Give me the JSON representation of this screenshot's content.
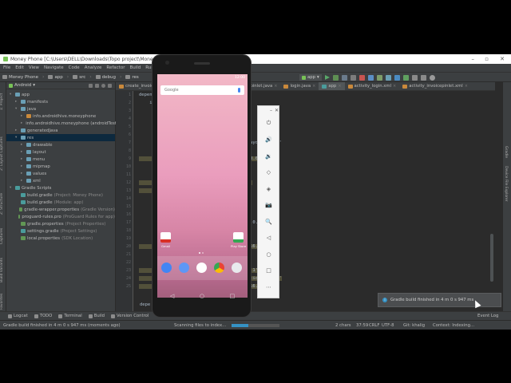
{
  "window": {
    "title": "Money Phone [C:\\Users\\DELL\\Downloads\\Topo project\\Money Phone] - app - Android Studio"
  },
  "menu": [
    "File",
    "Edit",
    "View",
    "Navigate",
    "Code",
    "Analyze",
    "Refactor",
    "Build",
    "Run",
    "Tools",
    "VCS",
    "Window",
    "Help"
  ],
  "toolbar": {
    "breadcrumbs": [
      "Money Phone",
      "app",
      "src",
      "debug",
      "res"
    ],
    "run_config": "app"
  },
  "project_panel": {
    "view_label": "Android",
    "tree": [
      {
        "label": "app",
        "indent": 0,
        "arrow": "▾",
        "icon": "folder-icon"
      },
      {
        "label": "manifests",
        "indent": 1,
        "arrow": "▸",
        "icon": "folder-icon"
      },
      {
        "label": "java",
        "indent": 1,
        "arrow": "▾",
        "icon": "folder-icon"
      },
      {
        "label": "info.androidhive.moneyphone",
        "indent": 2,
        "arrow": "▸",
        "icon": "package-icon"
      },
      {
        "label": "info.androidhive.moneyphone (androidTest)",
        "indent": 2,
        "arrow": "▸",
        "icon": "package-icon"
      },
      {
        "label": "generatedJava",
        "indent": 1,
        "arrow": "▸",
        "icon": "folder-icon"
      },
      {
        "label": "res",
        "indent": 1,
        "arrow": "▾",
        "icon": "folder-icon",
        "selected": true
      },
      {
        "label": "drawable",
        "indent": 2,
        "arrow": "▸",
        "icon": "folder-icon"
      },
      {
        "label": "layout",
        "indent": 2,
        "arrow": "▸",
        "icon": "folder-icon"
      },
      {
        "label": "menu",
        "indent": 2,
        "arrow": "▸",
        "icon": "folder-icon"
      },
      {
        "label": "mipmap",
        "indent": 2,
        "arrow": "▸",
        "icon": "folder-icon"
      },
      {
        "label": "values",
        "indent": 2,
        "arrow": "▸",
        "icon": "folder-icon"
      },
      {
        "label": "xml",
        "indent": 2,
        "arrow": "▸",
        "icon": "folder-icon"
      },
      {
        "label": "Gradle Scripts",
        "indent": 0,
        "arrow": "▾",
        "icon": "gradle-icon"
      },
      {
        "label": "build.gradle",
        "muted": "(Project: Money Phone)",
        "indent": 1,
        "icon": "gradle-file-icon"
      },
      {
        "label": "build.gradle",
        "muted": "(Module: app)",
        "indent": 1,
        "icon": "gradle-file-icon"
      },
      {
        "label": "gradle-wrapper.properties",
        "muted": "(Gradle Version)",
        "indent": 1,
        "icon": "properties-icon"
      },
      {
        "label": "proguard-rules.pro",
        "muted": "(ProGuard Rules for app)",
        "indent": 1,
        "icon": "properties-icon"
      },
      {
        "label": "gradle.properties",
        "muted": "(Project Properties)",
        "indent": 1,
        "icon": "properties-icon"
      },
      {
        "label": "settings.gradle",
        "muted": "(Project Settings)",
        "indent": 1,
        "icon": "gradle-file-icon"
      },
      {
        "label": "local.properties",
        "muted": "(SDK Location)",
        "indent": 1,
        "icon": "properties-icon"
      }
    ]
  },
  "editor": {
    "tabs": [
      {
        "label": "create_invoice.java",
        "icon": "java-icon"
      },
      {
        "label": "invoicenew.java",
        "icon": "java-icon"
      },
      {
        "label": "invoicepinlet.java",
        "icon": "java-icon"
      },
      {
        "label": "login.java",
        "icon": "java-icon"
      },
      {
        "label": "app",
        "icon": "gradle-icon",
        "active": true
      },
      {
        "label": "activity_login.xml",
        "icon": "xml-icon"
      },
      {
        "label": "activity_invoicepinlet.xml",
        "icon": "xml-icon"
      }
    ],
    "code_lines": [
      {
        "text": "dependencies {",
        "hl": false
      },
      {
        "text": "    i",
        "hl": false
      },
      {
        "text": "                                  ibs')",
        "hl": false
      },
      {
        "text": "                                  1.1'",
        "hl": false
      },
      {
        "text": "                                  1.1'",
        "hl": false
      },
      {
        "text": "",
        "hl": false
      },
      {
        "text": "                                  traint-layout:1.1.3'",
        "hl": false
      },
      {
        "text": "                                  :1.1'",
        "hl": false
      },
      {
        "text": "                                  ne-core:3.0.2'",
        "hl": true
      },
      {
        "text": "",
        "hl": false
      },
      {
        "text": "",
        "hl": false
      },
      {
        "text": "                                  0:27.1.1'",
        "hl": true
      },
      {
        "text": "                                  0.0'",
        "hl": true
      },
      {
        "text": "                                  28'",
        "hl": false
      },
      {
        "text": "",
        "hl": false
      },
      {
        "text": "",
        "hl": false
      },
      {
        "text": "                                  tions:29.0.0'",
        "hl": false
      },
      {
        "text": "",
        "hl": false
      },
      {
        "text": "",
        "hl": false
      },
      {
        "text": "                                  ne-auth:16.0.1'",
        "hl": true
      },
      {
        "text": "",
        "hl": false
      },
      {
        "text": "",
        "hl": false
      },
      {
        "text": "                                  ase:16.0.1'",
        "hl": true
      },
      {
        "text": "                                  ne-analytics:16.0.1'",
        "hl": true
      },
      {
        "text": "                                  ne-core:16.0.1'",
        "hl": true
      }
    ],
    "bottom_fragment": "depe"
  },
  "emulator": {
    "status_time": "12:00",
    "search_label": "Google",
    "apps": [
      {
        "label": "Gmail",
        "color": "#ffffff",
        "accent": "#d93025"
      },
      {
        "label": "Play Store",
        "color": "#ffffff",
        "accent": "#34a853"
      }
    ],
    "dock": [
      {
        "name": "phone",
        "color": "#4285f4"
      },
      {
        "name": "messages",
        "color": "#5e97f6"
      },
      {
        "name": "app-drawer",
        "color": "#ffffff"
      },
      {
        "name": "chrome",
        "color": "#fbbc05"
      },
      {
        "name": "camera",
        "color": "#e8eaed"
      }
    ],
    "nav": [
      "◁",
      "○",
      "□"
    ],
    "controls": [
      "⏻",
      "🔊",
      "🔉",
      "◇",
      "◈",
      "📷",
      "🔍",
      "◁",
      "○",
      "□",
      "⋯"
    ]
  },
  "notification": {
    "text": "Gradle build finished in 4 m 0 s 947 ms"
  },
  "bottom_tabs": [
    "Logcat",
    "TODO",
    "Terminal",
    "Build",
    "Version Control"
  ],
  "right_panel_label": "Event Log",
  "statusbar": {
    "message": "Gradle build finished in 4 m 0 s 947 ms (moments ago)",
    "progress": "Scanning files to index...",
    "info": "2 chars",
    "position": "37:59",
    "line_sep": "CRLF",
    "encoding": "UTF-8",
    "git": "Git: khalig",
    "context": "Context: Indexing..."
  },
  "side_labels": {
    "left": [
      "1: Project",
      "2: Layout Captures",
      "Z: Structure",
      "Captures",
      "Build Variants",
      "Favorites"
    ],
    "right": [
      "Gradle",
      "Device File Explorer"
    ]
  },
  "colors": {
    "ide_bg": "#2b2b2b",
    "panel_bg": "#3c3f41",
    "selection": "#0d293e",
    "highlight": "#52503a"
  }
}
